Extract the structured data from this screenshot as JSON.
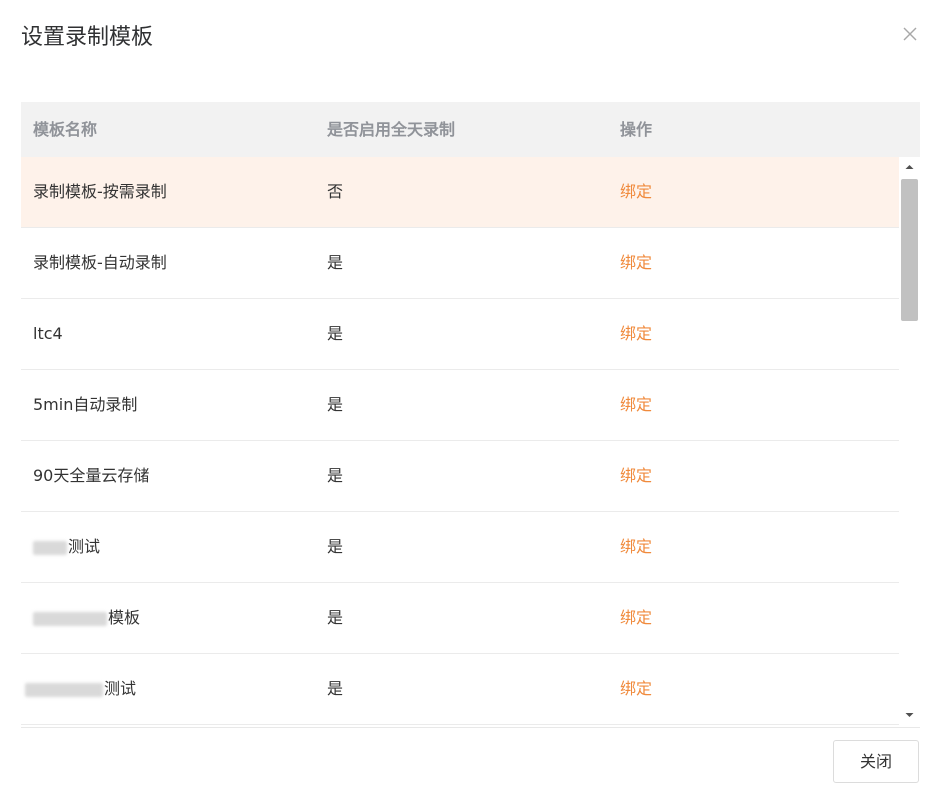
{
  "dialog": {
    "title": "设置录制模板",
    "close_icon": "close-icon"
  },
  "table": {
    "columns": [
      "模板名称",
      "是否启用全天录制",
      "操作"
    ],
    "rows": [
      {
        "name": "录制模板-按需录制",
        "all_day": "否",
        "action": "绑定",
        "highlighted": true
      },
      {
        "name": "录制模板-自动录制",
        "all_day": "是",
        "action": "绑定"
      },
      {
        "name": "ltc4",
        "all_day": "是",
        "action": "绑定"
      },
      {
        "name": "5min自动录制",
        "all_day": "是",
        "action": "绑定"
      },
      {
        "name": "90天全量云存储",
        "all_day": "是",
        "action": "绑定"
      },
      {
        "name": "测试",
        "all_day": "是",
        "action": "绑定",
        "redacted_prefix": true
      },
      {
        "name": "模板",
        "all_day": "是",
        "action": "绑定",
        "redacted_prefix": true
      },
      {
        "name": "测试",
        "all_day": "是",
        "action": "绑定",
        "redacted_prefix": true
      }
    ]
  },
  "footer": {
    "close_label": "关闭"
  },
  "colors": {
    "accent": "#f08a3c",
    "row_highlight": "#fef2ea",
    "header_bg": "#f2f2f2"
  }
}
